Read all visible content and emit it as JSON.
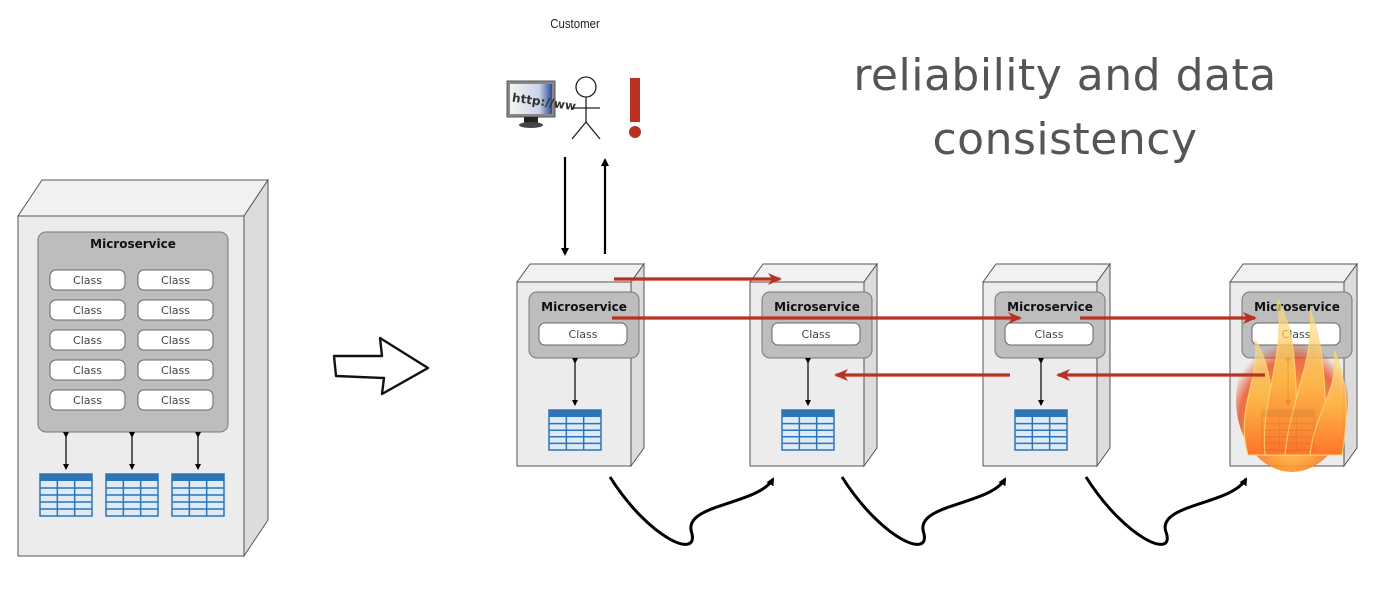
{
  "title": {
    "line1": "reliability and data",
    "line2": "consistency"
  },
  "customer": {
    "label": "Customer",
    "browser_icon_text": "http://ww",
    "alert_symbol": "!"
  },
  "monolith": {
    "header": "Microservice",
    "classes": [
      "Class",
      "Class",
      "Class",
      "Class",
      "Class",
      "Class",
      "Class",
      "Class",
      "Class",
      "Class"
    ],
    "databases": 3
  },
  "services": [
    {
      "header": "Microservice",
      "class_label": "Class",
      "state": "ok"
    },
    {
      "header": "Microservice",
      "class_label": "Class",
      "state": "ok"
    },
    {
      "header": "Microservice",
      "class_label": "Class",
      "state": "ok"
    },
    {
      "header": "Microservice",
      "class_label": "Class",
      "state": "on-fire"
    }
  ],
  "colors": {
    "accent_red": "#B83224",
    "box_face": "#ECECEC",
    "box_side": "#DCDCDC",
    "panel": "#BDBDBD",
    "db_blue": "#2E75B6",
    "db_light": "#DCEBF7",
    "text_gray": "#555555"
  }
}
